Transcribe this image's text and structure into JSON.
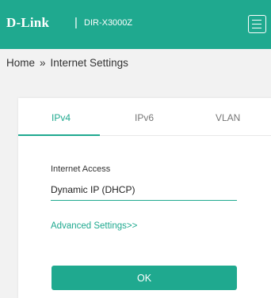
{
  "header": {
    "logo": "D-Link",
    "separator": "|",
    "model": "DIR-X3000Z",
    "menu_icon": "hamburger-menu-icon"
  },
  "breadcrumb": {
    "home": "Home",
    "separator": "»",
    "current": "Internet Settings"
  },
  "tabs": [
    {
      "label": "IPv4",
      "active": true
    },
    {
      "label": "IPv6",
      "active": false
    },
    {
      "label": "VLAN",
      "active": false
    }
  ],
  "form": {
    "internet_access_label": "Internet Access",
    "internet_access_value": "Dynamic IP (DHCP)",
    "advanced_settings_link": "Advanced Settings>>",
    "ok_button": "OK"
  },
  "colors": {
    "accent": "#1fa98f",
    "background": "#f2f2f2"
  }
}
